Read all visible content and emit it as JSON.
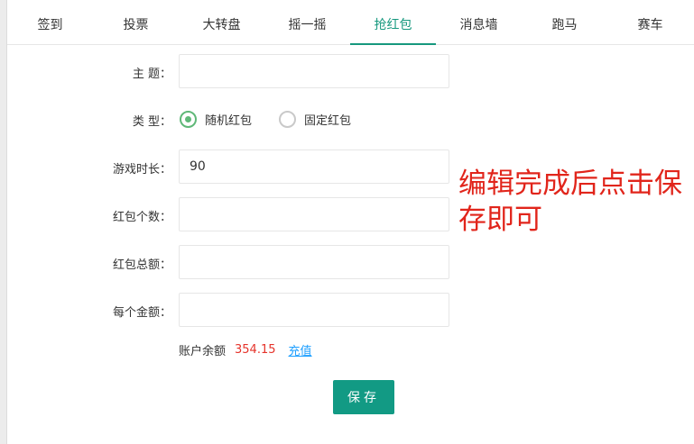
{
  "tabs": [
    {
      "label": "签到"
    },
    {
      "label": "投票"
    },
    {
      "label": "大转盘"
    },
    {
      "label": "摇一摇"
    },
    {
      "label": "抢红包"
    },
    {
      "label": "消息墙"
    },
    {
      "label": "跑马"
    },
    {
      "label": "赛车"
    }
  ],
  "active_tab": "抢红包",
  "form": {
    "subject_label": "主 题：",
    "subject_value": "",
    "type_label": "类 型：",
    "type_options": [
      "随机红包",
      "固定红包"
    ],
    "type_selected": "随机红包",
    "duration_label": "游戏时长：",
    "duration_value": "90",
    "count_label": "红包个数：",
    "count_value": "",
    "total_label": "红包总额：",
    "total_value": "",
    "each_label": "每个金额：",
    "each_value": ""
  },
  "balance": {
    "label": "账户余额",
    "value": "354.15",
    "recharge_label": "充值"
  },
  "save_label": "保存",
  "annotation": "编辑完成后点击保存即可",
  "colors": {
    "accent": "#16987e",
    "button": "#129a84",
    "radio_checked": "#5fb878",
    "balance": "#e5332a",
    "link": "#1e9fff",
    "annotation": "#e1251b"
  }
}
